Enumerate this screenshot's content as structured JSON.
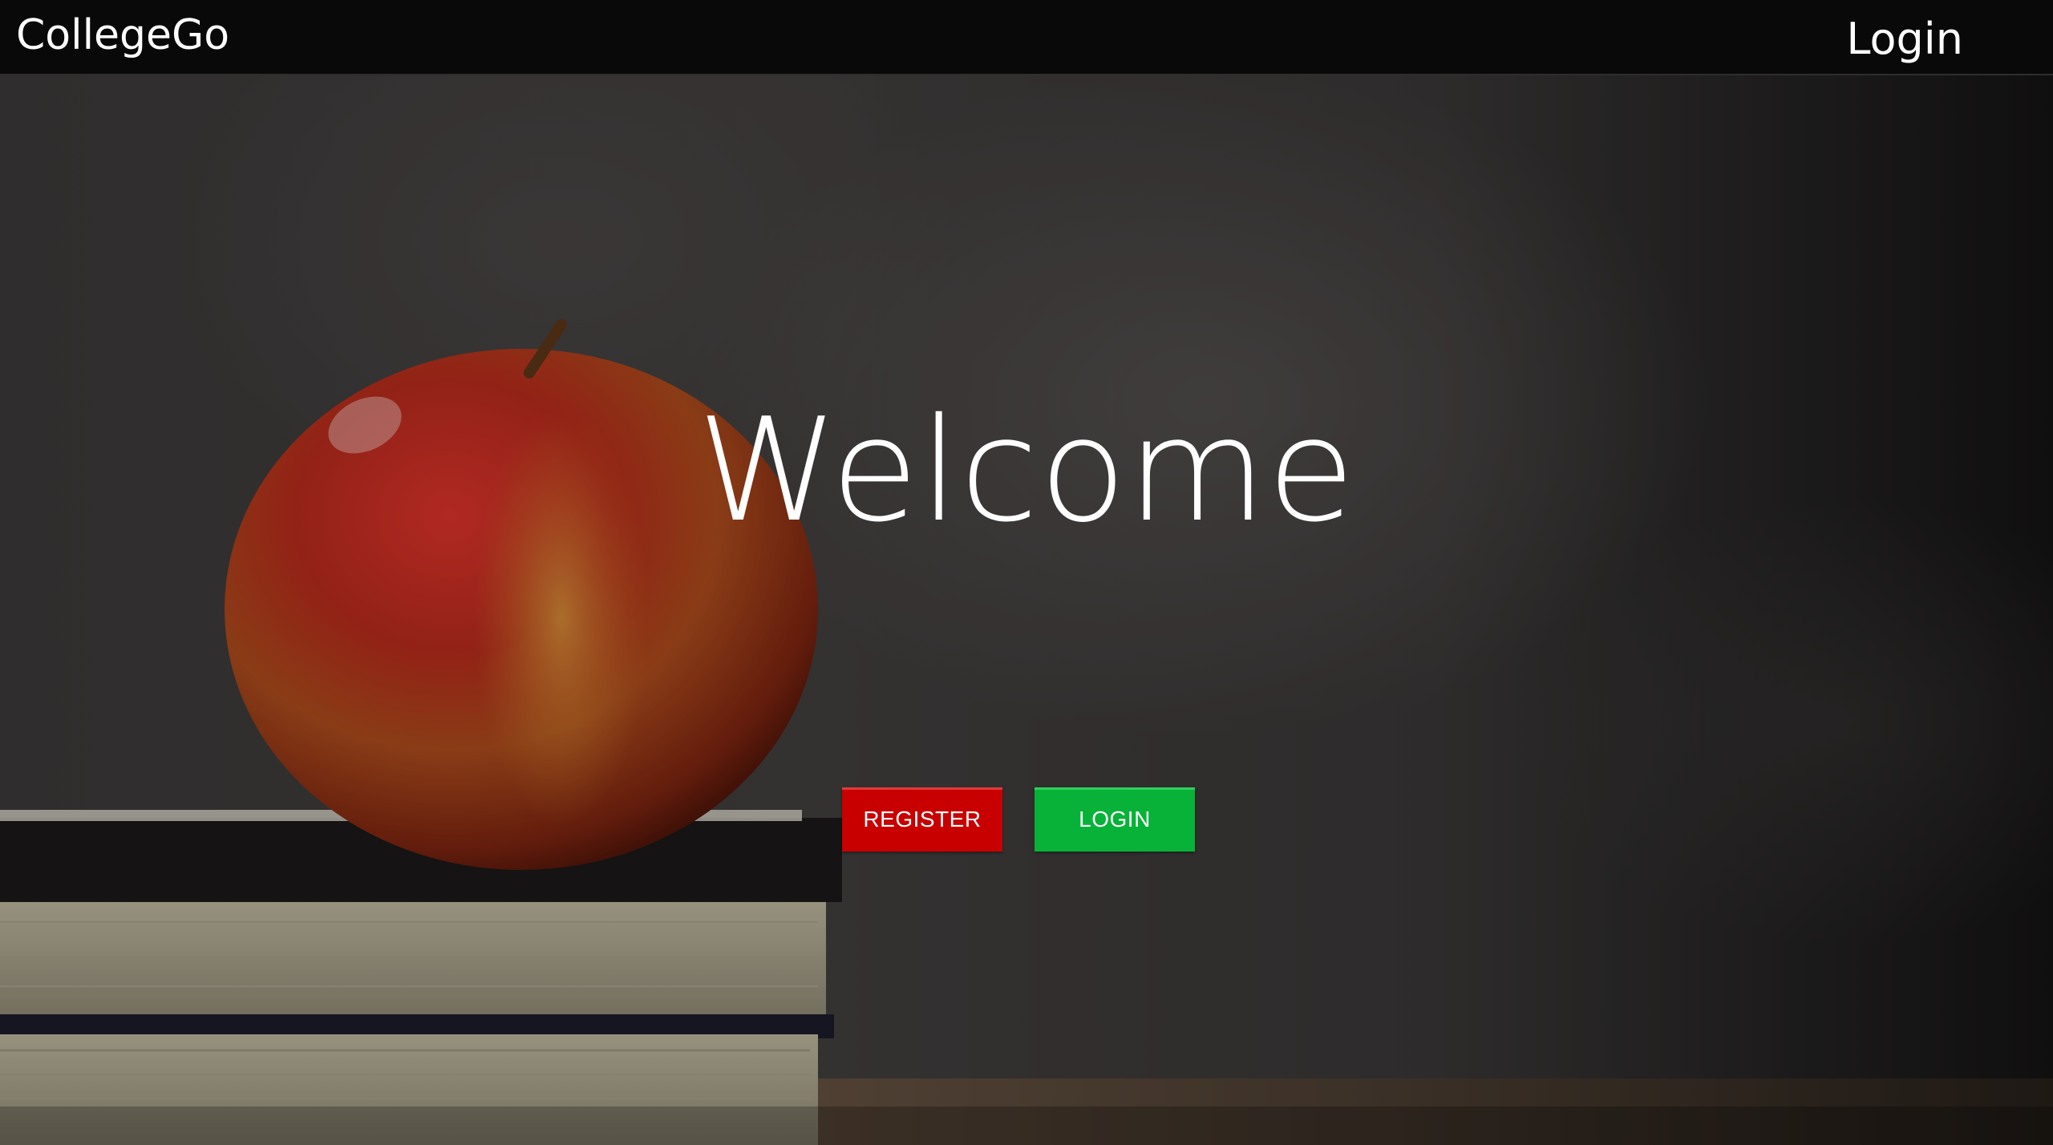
{
  "navbar": {
    "brand": "CollegeGo",
    "login_link": "Login"
  },
  "hero": {
    "title": "Welcome",
    "register_button": "REGISTER",
    "login_button": "LOGIN"
  },
  "colors": {
    "navbar_bg": "#090909",
    "register_button": "#c80000",
    "login_button": "#08b238",
    "text": "#ffffff"
  },
  "background_image": "apple-on-books-chalkboard"
}
